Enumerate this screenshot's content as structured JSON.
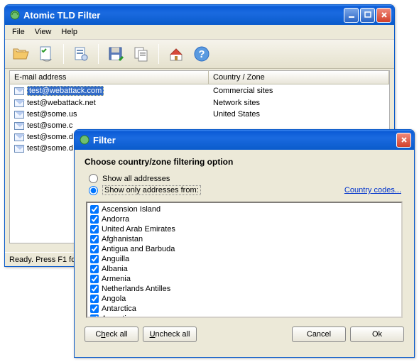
{
  "main_window": {
    "title": "Atomic TLD Filter",
    "menu": [
      "File",
      "View",
      "Help"
    ],
    "toolbar_icons": [
      "open-folder",
      "checklist",
      "settings-doc",
      "save-floppy",
      "copy-doc",
      "home",
      "help"
    ],
    "columns": {
      "email": "E-mail address",
      "country": "Country / Zone"
    },
    "rows": [
      {
        "email": "test@webattack.com",
        "country": "Commercial sites",
        "selected": true
      },
      {
        "email": "test@webattack.net",
        "country": "Network sites",
        "selected": false
      },
      {
        "email": "test@some.us",
        "country": "United States",
        "selected": false
      },
      {
        "email": "test@some.c",
        "country": "",
        "selected": false
      },
      {
        "email": "test@some.d",
        "country": "",
        "selected": false
      },
      {
        "email": "test@some.d",
        "country": "",
        "selected": false
      }
    ],
    "status": "Ready. Press F1 fo"
  },
  "filter_dialog": {
    "title": "Filter",
    "heading": "Choose country/zone filtering option",
    "radio_all": "Show all addresses",
    "radio_only": "Show only addresses from:",
    "selected_radio": "only",
    "country_codes_link": "Country codes...",
    "countries": [
      "Ascension Island",
      "Andorra",
      "United Arab Emirates",
      "Afghanistan",
      "Antigua and Barbuda",
      "Anguilla",
      "Albania",
      "Armenia",
      "Netherlands Antilles",
      "Angola",
      "Antarctica",
      "Argentina"
    ],
    "buttons": {
      "check_all_pre": "C",
      "check_all_ul": "h",
      "check_all_post": "eck all",
      "uncheck_all_pre": "",
      "uncheck_all_ul": "U",
      "uncheck_all_post": "ncheck all",
      "cancel": "Cancel",
      "ok": "Ok"
    }
  }
}
